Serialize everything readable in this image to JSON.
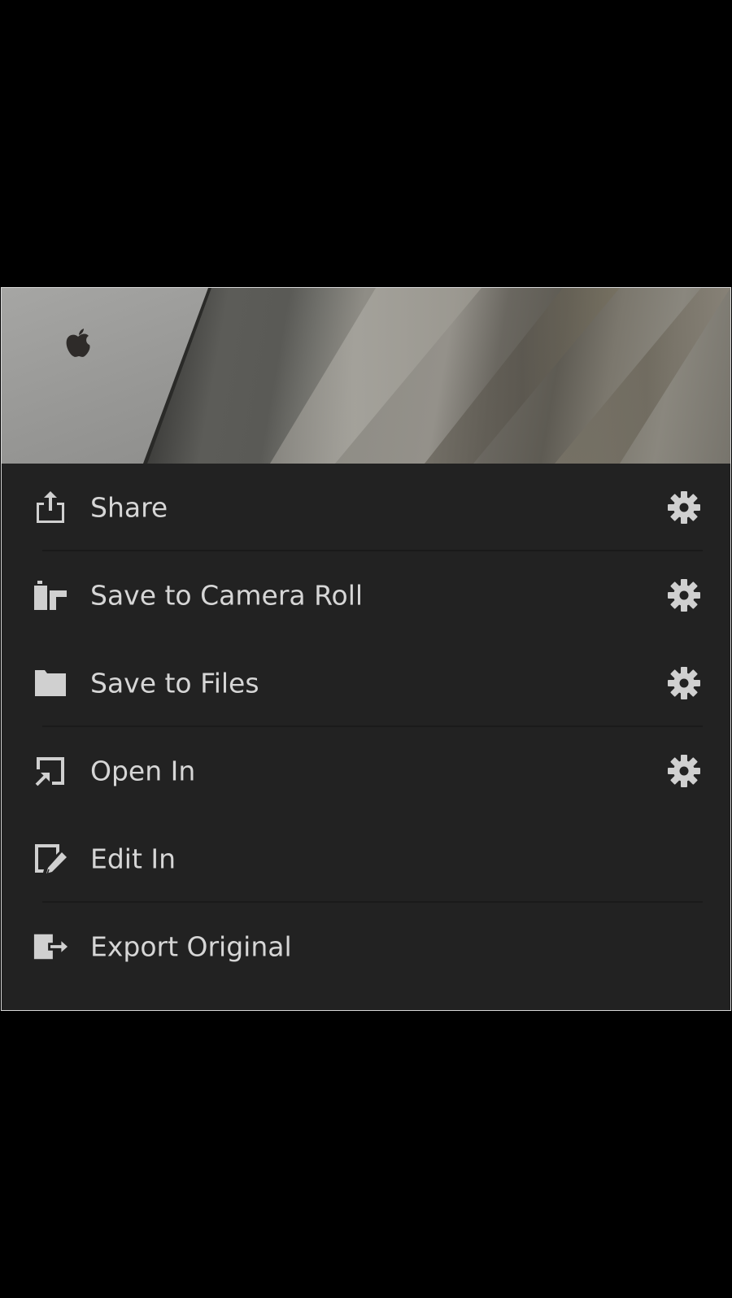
{
  "menu": {
    "items": [
      {
        "label": "Share",
        "icon": "share-icon",
        "has_settings": true,
        "divider_after": true
      },
      {
        "label": "Save to Camera Roll",
        "icon": "camera-roll-icon",
        "has_settings": true,
        "divider_after": false
      },
      {
        "label": "Save to Files",
        "icon": "folder-icon",
        "has_settings": true,
        "divider_after": true
      },
      {
        "label": "Open In",
        "icon": "open-in-icon",
        "has_settings": true,
        "divider_after": false
      },
      {
        "label": "Edit In",
        "icon": "edit-in-icon",
        "has_settings": false,
        "divider_after": true
      },
      {
        "label": "Export Original",
        "icon": "export-icon",
        "has_settings": false,
        "divider_after": false
      }
    ]
  },
  "colors": {
    "background": "#000000",
    "sheet": "#222222",
    "text": "#d6d6d6",
    "icon": "#d0d0d0",
    "divider": "#1a1a1a"
  }
}
